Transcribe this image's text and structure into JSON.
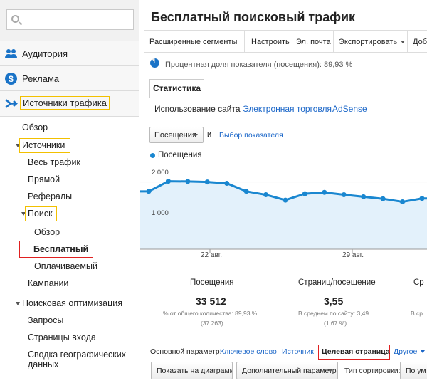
{
  "sidebar": {
    "search": {
      "placeholder": "",
      "icon": "search-icon"
    },
    "sections": [
      {
        "label": "Аудитория",
        "icon": "audience-icon"
      },
      {
        "label": "Реклама",
        "icon": "dollar-icon"
      },
      {
        "label": "Источники трафика",
        "icon": "traffic-sources-icon"
      }
    ],
    "items": {
      "overview": "Обзор",
      "sources": "Источники",
      "all_traffic": "Весь трафик",
      "direct": "Прямой",
      "referrals": "Рефералы",
      "search": "Поиск",
      "search_overview": "Обзор",
      "organic": "Бесплатный",
      "paid": "Оплачиваемый",
      "campaigns": "Кампании",
      "seo": "Поисковая оптимизация",
      "queries": "Запросы",
      "landing_pages": "Страницы входа",
      "geo_line1": "Сводка географических",
      "geo_line2": "данных"
    }
  },
  "header": {
    "title": "Бесплатный поисковый трафик"
  },
  "toolbar": {
    "advanced_segments": "Расширенные сегменты",
    "customize": "Настроить",
    "email": "Эл. почта",
    "export": "Экспортировать",
    "add_partial": "Доб"
  },
  "percent_note": "Процентная доля показателя (посещения): 89,93 %",
  "tabs": {
    "statistics": "Статистика"
  },
  "subtabs": {
    "site_usage": "Использование сайта",
    "ecommerce": "Электронная торговля",
    "adsense": "AdSense"
  },
  "metric_selector": {
    "value": "Посещения",
    "and": "и",
    "choose_metric": "Выбор показателя"
  },
  "chart_data": {
    "type": "area",
    "series": [
      {
        "name": "Посещения",
        "values": [
          1720,
          2020,
          2015,
          2000,
          1960,
          1720,
          1620,
          1460,
          1650,
          1690,
          1620,
          1560,
          1500,
          1410,
          1510
        ]
      }
    ],
    "y_ticks": [
      "2 000",
      "1 000"
    ],
    "x_ticks": [
      "22 авг.",
      "29 авг."
    ],
    "ylim": [
      0,
      2500
    ],
    "color": "#1a87d0",
    "fill_color": "#e3f1fb"
  },
  "scorecards": [
    {
      "title": "Посещения",
      "value": "33 512",
      "sub1": "% от общего количества: 89,93 %",
      "sub2": "(37 263)"
    },
    {
      "title": "Страниц/посещение",
      "value": "3,55",
      "sub1": "В среднем по сайту: 3,49",
      "sub2": "(1,67 %)"
    },
    {
      "title": "Ср",
      "value": "",
      "sub1": "В ср",
      "sub2": ""
    }
  ],
  "dimensions": {
    "label": "Основной параметр:",
    "keyword": "Ключевое слово",
    "source": "Источник",
    "landing_page": "Целевая страница",
    "other": "Другое"
  },
  "bottom_controls": {
    "plot_rows": "Показать на диаграмме",
    "secondary_dimension": "Дополнительный параметр",
    "sort_type_label": "Тип сортировки:",
    "sort_value": "По ум"
  }
}
